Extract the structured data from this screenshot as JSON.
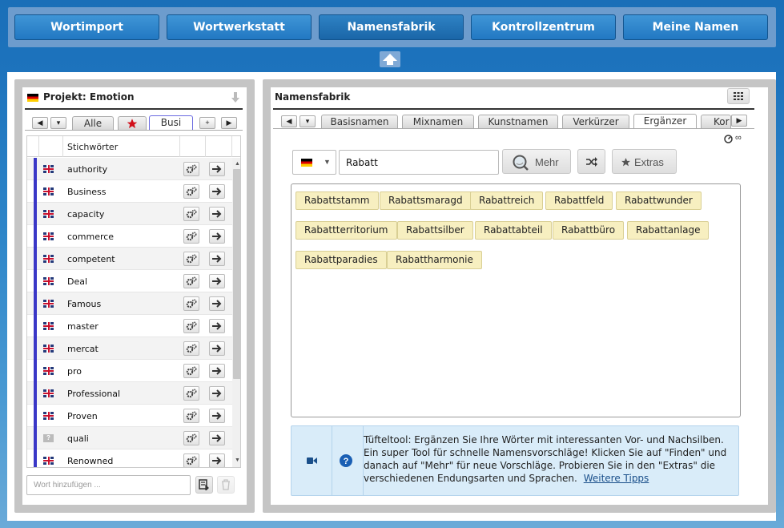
{
  "nav": {
    "items": [
      {
        "label": "Wortimport"
      },
      {
        "label": "Wortwerkstatt"
      },
      {
        "label": "Namensfabrik"
      },
      {
        "label": "Kontrollzentrum"
      },
      {
        "label": "Meine Namen"
      }
    ],
    "active": "Namensfabrik"
  },
  "project": {
    "title": "Projekt: Emotion",
    "tabs": [
      {
        "label": "Alle"
      },
      {
        "label": "favorites-star"
      },
      {
        "label": "Busi"
      }
    ],
    "add_tab": "+",
    "table_header": "Stichwörter",
    "words": [
      {
        "flag": "uk",
        "word": "authority"
      },
      {
        "flag": "uk",
        "word": "Business"
      },
      {
        "flag": "uk",
        "word": "capacity"
      },
      {
        "flag": "uk",
        "word": "commerce"
      },
      {
        "flag": "uk",
        "word": "competent"
      },
      {
        "flag": "uk",
        "word": "Deal"
      },
      {
        "flag": "uk",
        "word": "Famous"
      },
      {
        "flag": "uk",
        "word": "master"
      },
      {
        "flag": "uk",
        "word": "mercat"
      },
      {
        "flag": "uk",
        "word": "pro"
      },
      {
        "flag": "uk",
        "word": "Professional"
      },
      {
        "flag": "uk",
        "word": "Proven"
      },
      {
        "flag": "unknown",
        "word": "quali"
      },
      {
        "flag": "uk",
        "word": "Renowned"
      }
    ],
    "add_word_placeholder": "Wort hinzufügen ..."
  },
  "factory": {
    "title": "Namensfabrik",
    "tabs": [
      {
        "label": "Basisnamen"
      },
      {
        "label": "Mixnamen"
      },
      {
        "label": "Kunstnamen"
      },
      {
        "label": "Verkürzer"
      },
      {
        "label": "Ergänzer"
      },
      {
        "label": "Kor"
      }
    ],
    "selected_tab": "Ergänzer",
    "infinity": "∞",
    "language": "de",
    "search_value": "Rabatt",
    "more_label": "Mehr",
    "extras_label": "Extras",
    "results": [
      "Rabattstamm",
      "Rabattsmaragd",
      "Rabattreich",
      "Rabattfeld",
      "Rabattwunder",
      "Rabattterritorium",
      "Rabattsilber",
      "Rabattabteil",
      "Rabattbüro",
      "Rabattanlage",
      "Rabattparadies",
      "Rabattharmonie"
    ],
    "tip_text": "Tüfteltool: Ergänzen Sie Ihre Wörter mit interessanten Vor- und Nachsilben. Ein super Tool für schnelle Namensvorschläge! Klicken Sie auf \"Finden\" und danach auf \"Mehr\" für neue Vorschläge. Probieren Sie in den \"Extras\" die verschiedenen Endungsarten und Sprachen.",
    "tip_link": "Weitere Tipps"
  },
  "colors": {
    "nav_bg": "#2278c2",
    "chip_bg": "#f7efc0",
    "tip_bg": "#d9ecf9",
    "row_marker": "#3a37c7"
  }
}
